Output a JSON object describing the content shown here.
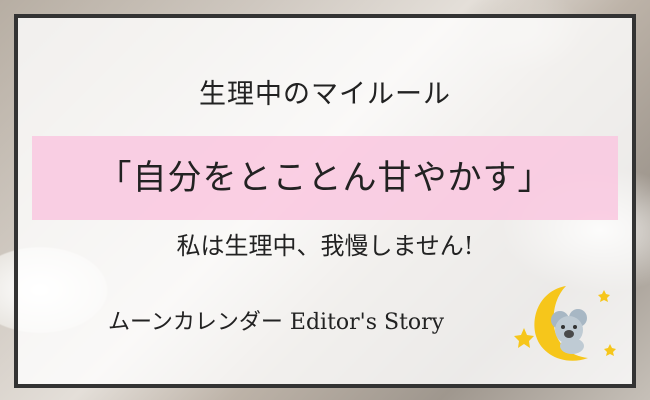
{
  "card": {
    "subtitle": "生理中のマイルール",
    "headline": "「自分をとことん甘やかす」",
    "tagline": "私は生理中、我慢しません!",
    "credit": "ムーンカレンダー Editor's Story"
  },
  "colors": {
    "frame": "#333333",
    "band": "#F9C8E0",
    "text": "#222222",
    "moon": "#F6C61B"
  },
  "icons": {
    "mascot": "moon-koala-icon"
  }
}
